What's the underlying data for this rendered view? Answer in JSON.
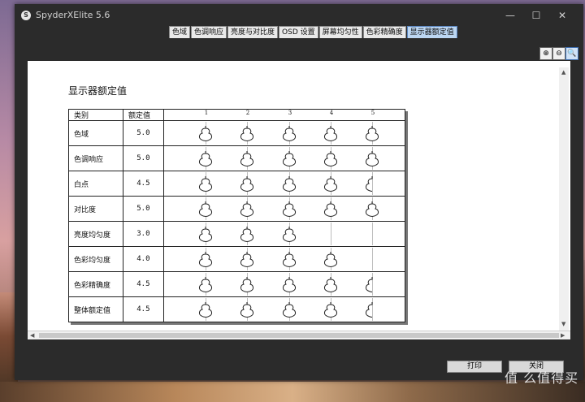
{
  "window": {
    "title": "SpyderXElite 5.6",
    "logo_letter": "S"
  },
  "tabs": [
    {
      "label": "色域",
      "active": false
    },
    {
      "label": "色调响应",
      "active": false
    },
    {
      "label": "亮度与对比度",
      "active": false
    },
    {
      "label": "OSD 设置",
      "active": false
    },
    {
      "label": "屏幕均匀性",
      "active": false
    },
    {
      "label": "色彩精确度",
      "active": false
    },
    {
      "label": "显示器额定值",
      "active": true
    }
  ],
  "toolbar": {
    "zoom_in": "⊕",
    "zoom_out": "⊖",
    "zoom_fit": "🔍"
  },
  "report": {
    "title": "显示器额定值",
    "headers": {
      "category": "类别",
      "rating": "额定值"
    },
    "scale": [
      "1",
      "2",
      "3",
      "4",
      "5"
    ],
    "rows": [
      {
        "category": "色域",
        "rating": "5.0",
        "value": 5.0
      },
      {
        "category": "色调响应",
        "rating": "5.0",
        "value": 5.0
      },
      {
        "category": "白点",
        "rating": "4.5",
        "value": 4.5
      },
      {
        "category": "对比度",
        "rating": "5.0",
        "value": 5.0
      },
      {
        "category": "亮度均匀度",
        "rating": "3.0",
        "value": 3.0
      },
      {
        "category": "色彩均匀度",
        "rating": "4.0",
        "value": 4.0
      },
      {
        "category": "色彩精确度",
        "rating": "4.5",
        "value": 4.5
      },
      {
        "category": "整体额定值",
        "rating": "4.5",
        "value": 4.5
      }
    ]
  },
  "buttons": {
    "print": "打印",
    "close": "关闭"
  },
  "watermark": {
    "text": "值 么值得买"
  }
}
